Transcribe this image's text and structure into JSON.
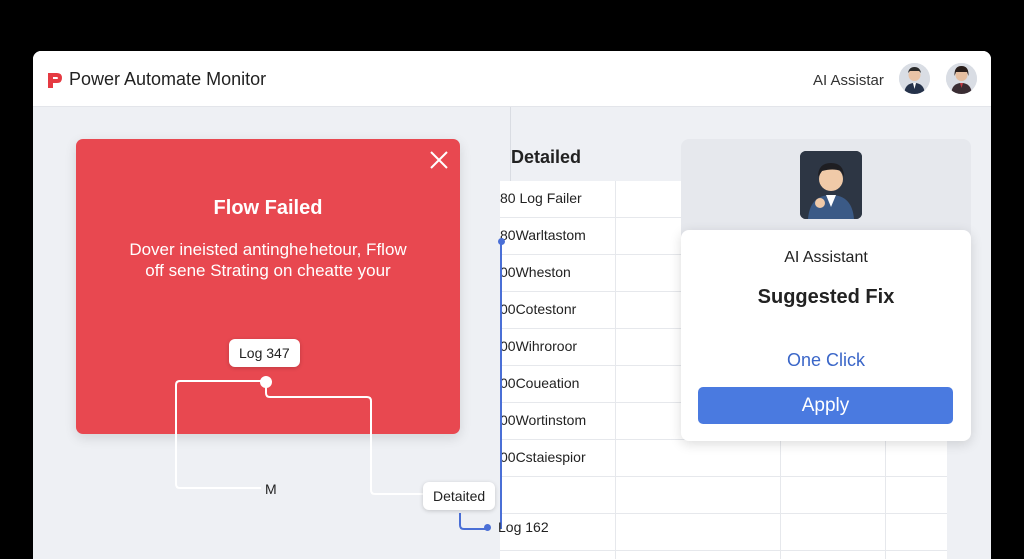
{
  "header": {
    "app_title": "Power Automate Monitor",
    "assistant_label": "AI Assistar",
    "logo_icon": "power-automate-logo-icon",
    "brand_color": "#e53a42"
  },
  "error_card": {
    "title": "Flow Failed",
    "message_line1": "Dover ineisted antinghe hetour, Fflow",
    "message_line2": "off sene Strating on cheatte your",
    "close_icon": "close-icon",
    "color": "#e84850"
  },
  "flow": {
    "log_pill": "Log 347",
    "detail_pill": "Detaited",
    "m_label": "M",
    "log_end": "Log 162"
  },
  "log_panel": {
    "heading": "Detailed",
    "rows": [
      "80 Log Failer",
      "80Warltastom",
      "00Wheston",
      "00Cotestonr",
      "00Wihroroor",
      "00Coueation",
      "00Wortinstom",
      "00Cstaiespior"
    ],
    "timeline_color": "#4a6fd6"
  },
  "ai_panel": {
    "title": "AI Assistant",
    "heading": "Suggested Fix",
    "one_click": "One Click",
    "apply_label": "Apply",
    "accent_color": "#4a7ae0"
  }
}
